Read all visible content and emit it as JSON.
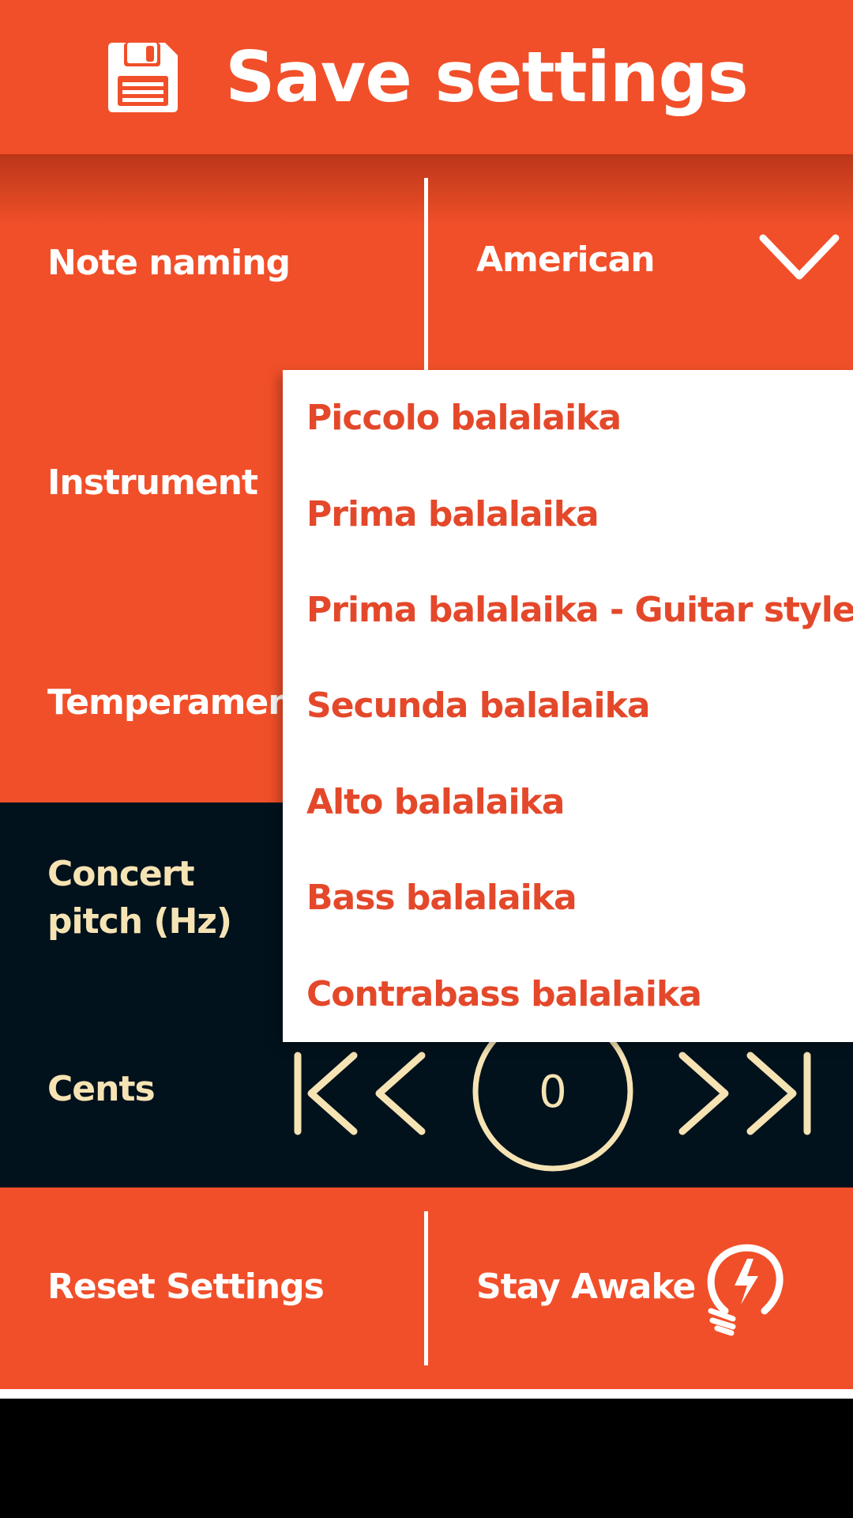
{
  "header": {
    "title": "Save settings",
    "icon": "floppy-disk-icon"
  },
  "settings": {
    "note_naming": {
      "label": "Note naming",
      "value": "American"
    },
    "instrument": {
      "label": "Instrument"
    },
    "temperament": {
      "label": "Temperament"
    }
  },
  "concert_pitch": {
    "label_line1": "Concert",
    "label_line2": "pitch (Hz)"
  },
  "cents": {
    "label": "Cents",
    "value": "0"
  },
  "dropdown": {
    "options": [
      "Piccolo balalaika",
      "Prima balalaika",
      "Prima balalaika - Guitar style",
      "Secunda balalaika",
      "Alto balalaika",
      "Bass balalaika",
      "Contrabass balalaika"
    ]
  },
  "footer": {
    "reset_label": "Reset Settings",
    "stay_awake_label": "Stay Awake",
    "stay_awake_icon": "lightbulb-bolt-icon"
  },
  "colors": {
    "accent": "#F14F29",
    "menu_text": "#E4482A",
    "dark_panel": "#02121C",
    "cream": "#F6E3B4"
  }
}
